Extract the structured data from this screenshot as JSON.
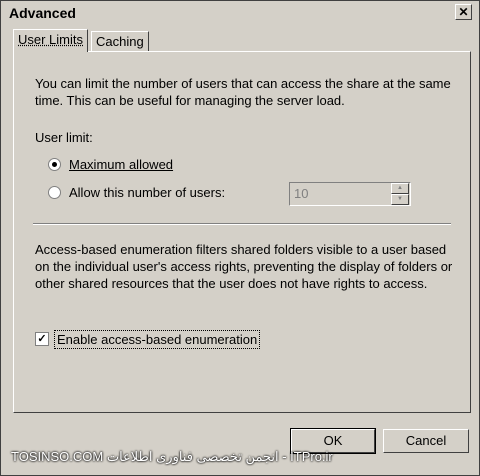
{
  "window": {
    "title": "Advanced",
    "close_symbol": "✕"
  },
  "tabs": [
    {
      "label": "User Limits"
    },
    {
      "label": "Caching"
    }
  ],
  "user_limits": {
    "description": "You can limit the number of users that can access the share at the same time. This can be useful for managing the server load.",
    "user_limit_label": "User limit:",
    "option_max": "Maximum allowed",
    "option_allow": "Allow this number of users:",
    "users_value": "10",
    "abe_description": "Access-based enumeration filters shared folders visible to a user based on the individual user's access rights, preventing the display of folders or other shared resources that the user does not have rights to access.",
    "abe_checkbox_label": "Enable access-based enumeration"
  },
  "buttons": {
    "ok": "OK",
    "cancel": "Cancel"
  },
  "watermark": "TOSINSO.COM  انجمن تخصصی فناوری اطلاعات - ITPro.ir"
}
